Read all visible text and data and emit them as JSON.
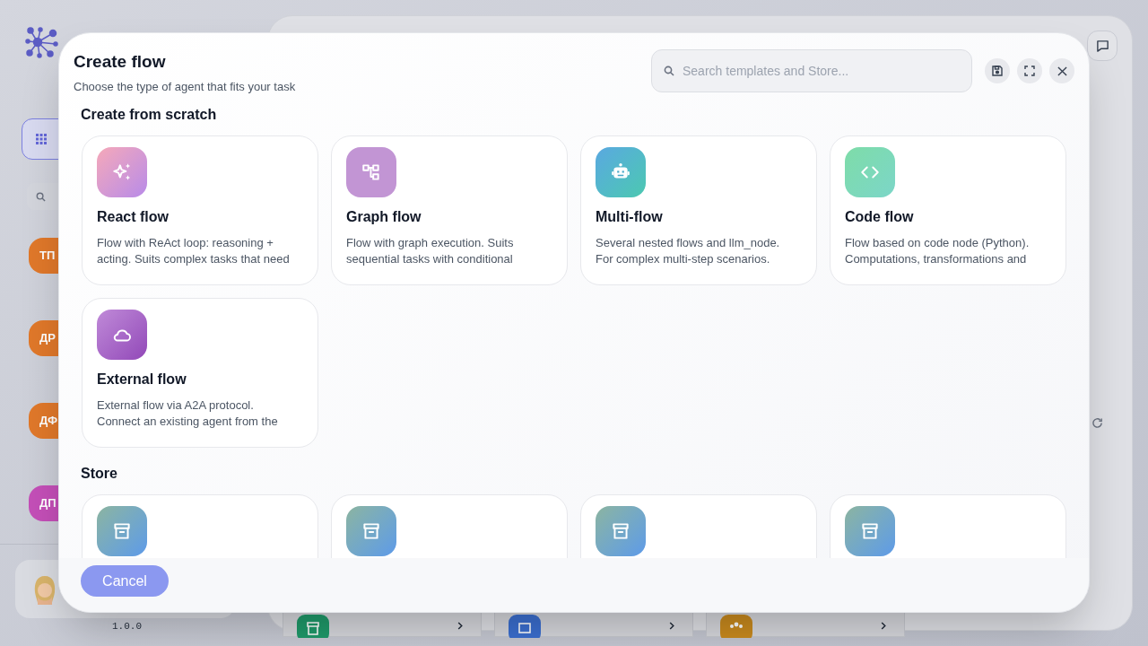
{
  "background": {
    "sidebar": {
      "badges": [
        {
          "label": "ТП",
          "color": "#e0782a"
        },
        {
          "label": "ДР",
          "color": "#e0782a"
        },
        {
          "label": "ДФ",
          "color": "#e0782a"
        },
        {
          "label": "ДП",
          "color": "#c44fb8"
        }
      ],
      "version": "1.0.0"
    }
  },
  "modal": {
    "title": "Create flow",
    "subtitle": "Choose the type of agent that fits your task",
    "search": {
      "placeholder": "Search templates and Store..."
    },
    "sections": [
      {
        "title": "Create from scratch",
        "cards": [
          {
            "kind": "react",
            "title": "React flow",
            "description": "Flow with ReAct loop: reasoning + acting. Suits complex tasks that need"
          },
          {
            "kind": "graph",
            "title": "Graph flow",
            "description": "Flow with graph execution. Suits sequential tasks with conditional"
          },
          {
            "kind": "multi",
            "title": "Multi-flow",
            "description": "Several nested flows and llm_node. For complex multi-step scenarios."
          },
          {
            "kind": "code",
            "title": "Code flow",
            "description": "Flow based on code node (Python). Computations, transformations and"
          },
          {
            "kind": "external",
            "title": "External flow",
            "description": "External flow via A2A protocol. Connect an existing agent from the"
          }
        ]
      },
      {
        "title": "Store",
        "cards": [
          {
            "kind": "store"
          },
          {
            "kind": "store"
          },
          {
            "kind": "store"
          },
          {
            "kind": "store"
          }
        ]
      }
    ],
    "cancel_button": "Cancel"
  }
}
